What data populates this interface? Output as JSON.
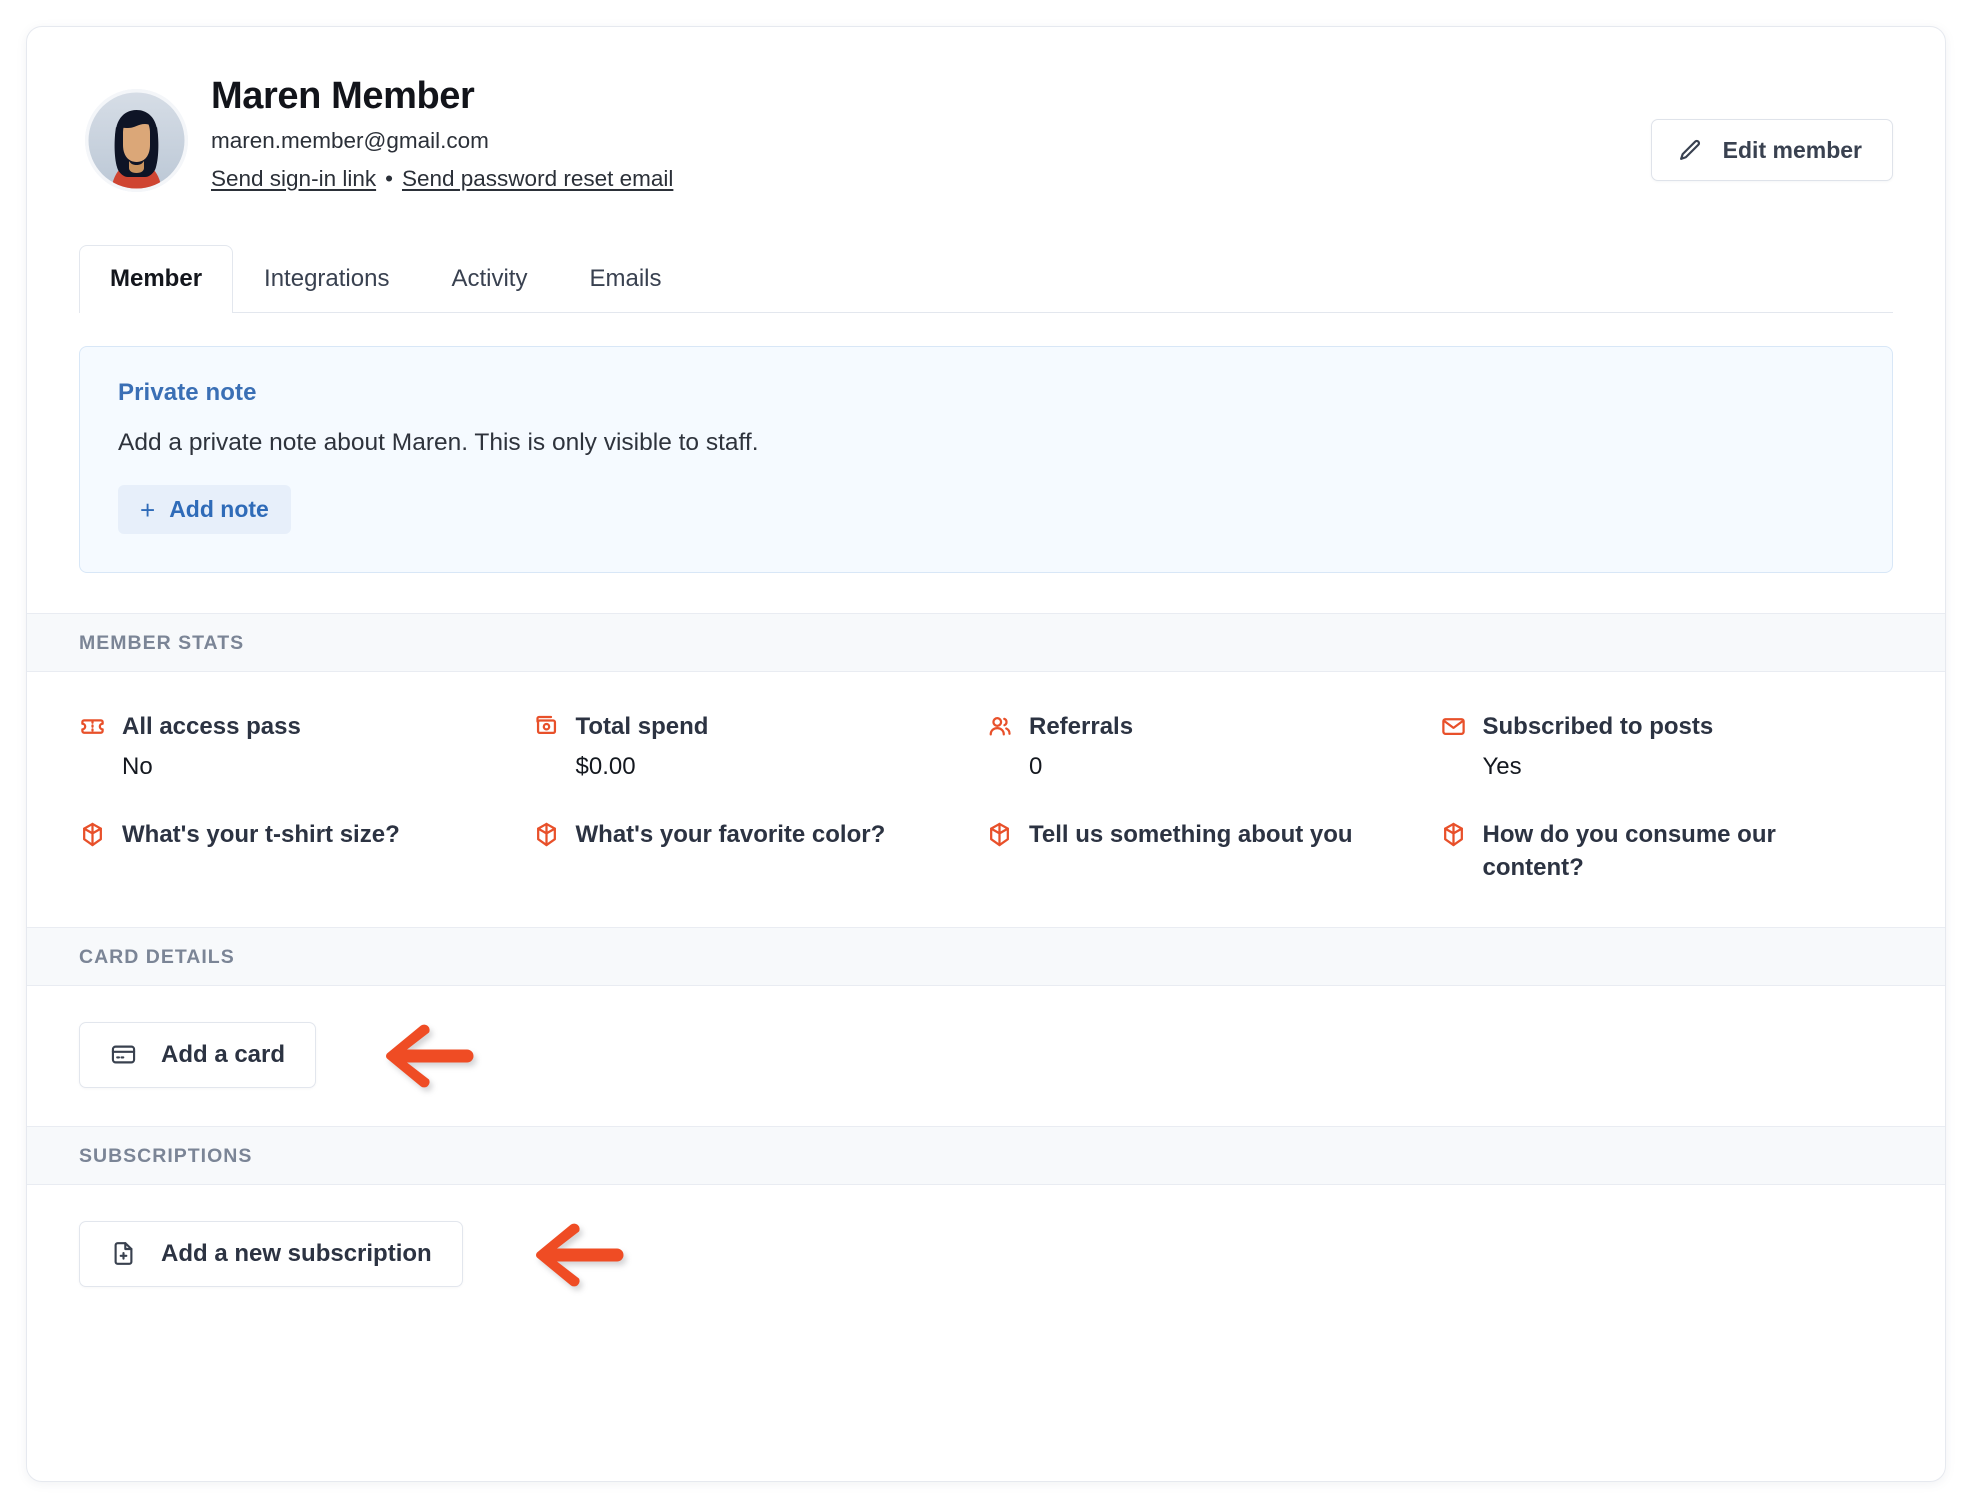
{
  "header": {
    "name": "Maren Member",
    "email": "maren.member@gmail.com",
    "signin_link": "Send sign-in link",
    "separator": "•",
    "password_reset_link": "Send password reset email",
    "edit_button": "Edit member",
    "edit_icon": "pencil-icon",
    "avatar_icon": "member-avatar"
  },
  "tabs": [
    {
      "label": "Member",
      "active": true
    },
    {
      "label": "Integrations",
      "active": false
    },
    {
      "label": "Activity",
      "active": false
    },
    {
      "label": "Emails",
      "active": false
    }
  ],
  "private_note": {
    "title": "Private note",
    "description": "Add a private note about Maren. This is only visible to staff.",
    "add_button": "Add note",
    "add_icon": "plus-icon"
  },
  "member_stats": {
    "section_title": "MEMBER STATS",
    "items": [
      {
        "icon": "ticket-icon",
        "label": "All access pass",
        "value": "No"
      },
      {
        "icon": "money-card-icon",
        "label": "Total spend",
        "value": "$0.00"
      },
      {
        "icon": "people-icon",
        "label": "Referrals",
        "value": "0"
      },
      {
        "icon": "envelope-icon",
        "label": "Subscribed to posts",
        "value": "Yes"
      },
      {
        "icon": "box-icon",
        "label": "What's your t-shirt size?",
        "value": ""
      },
      {
        "icon": "box-icon",
        "label": "What's your favorite color?",
        "value": ""
      },
      {
        "icon": "box-icon",
        "label": "Tell us something about you",
        "value": ""
      },
      {
        "icon": "box-icon",
        "label": "How do you consume our content?",
        "value": ""
      }
    ]
  },
  "card_details": {
    "section_title": "CARD DETAILS",
    "add_card_button": "Add a card",
    "add_card_icon": "credit-card-icon",
    "annotation_arrow": "arrow-left-icon"
  },
  "subscriptions": {
    "section_title": "SUBSCRIPTIONS",
    "add_subscription_button": "Add a new subscription",
    "add_subscription_icon": "document-plus-icon",
    "annotation_arrow": "arrow-left-icon"
  },
  "colors": {
    "accent_orange": "#e8502a",
    "link_blue": "#3a6fb5",
    "note_bg": "#f5faff",
    "section_band_bg": "#f7f9fb",
    "text_dark": "#2c3342",
    "muted": "#7b8596"
  }
}
